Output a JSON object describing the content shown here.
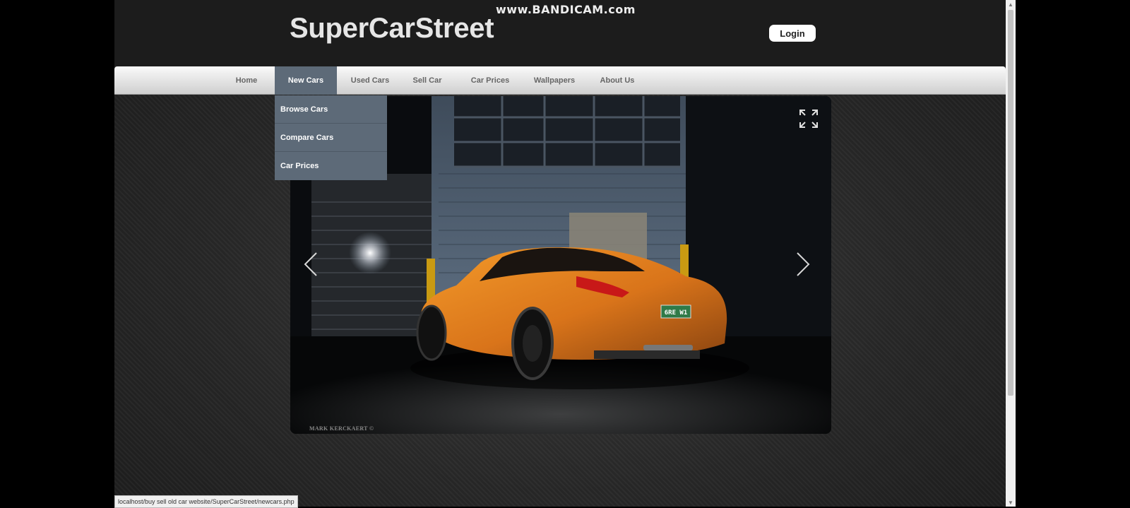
{
  "watermark": "www.BANDICAM.com",
  "header": {
    "logo": "SuperCarStreet",
    "login_label": "Login"
  },
  "nav": {
    "items": [
      {
        "label": "Home"
      },
      {
        "label": "New Cars"
      },
      {
        "label": "Used Cars"
      },
      {
        "label": "Sell Car"
      },
      {
        "label": "Car Prices"
      },
      {
        "label": "Wallpapers"
      },
      {
        "label": "About Us"
      }
    ],
    "active_index": 1
  },
  "dropdown": {
    "items": [
      {
        "label": "Browse Cars"
      },
      {
        "label": "Compare Cars"
      },
      {
        "label": "Car Prices"
      }
    ]
  },
  "slider": {
    "photo_credit": "MARK KERCKAERT ©",
    "plate_text": "6RE W1",
    "car_color": "#e0801a"
  },
  "statusbar": {
    "url": "localhost/buy sell old car website/SuperCarStreet/newcars.php"
  },
  "colors": {
    "nav_active": "#5d6a78",
    "header_bg": "#1c1c1c"
  }
}
